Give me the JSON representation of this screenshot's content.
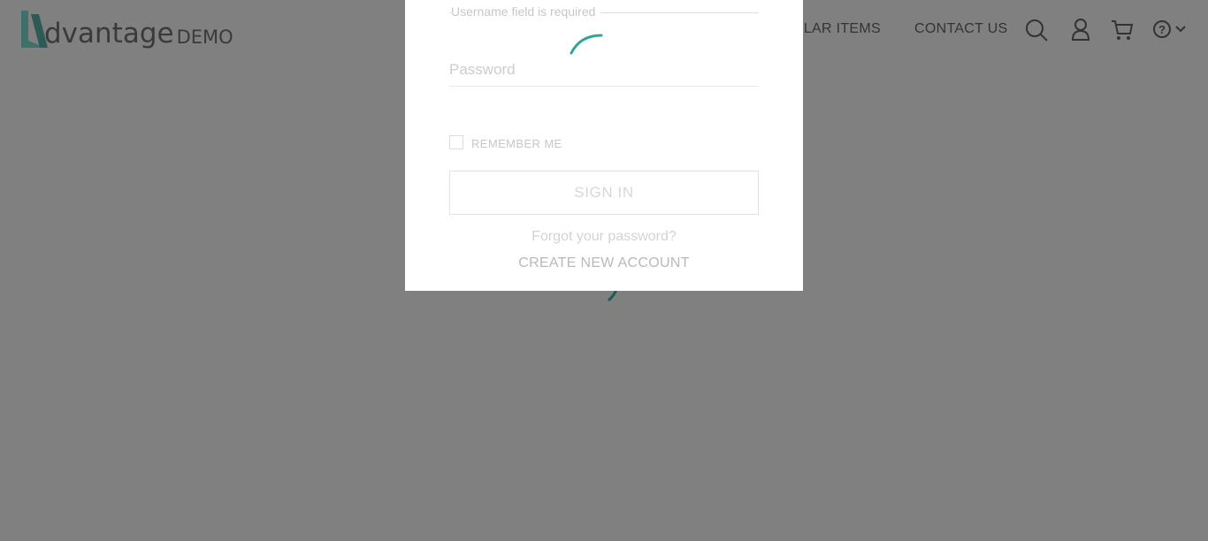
{
  "brand": {
    "word": "dvantage",
    "suffix": "DEMO",
    "accent": "#3f7f77"
  },
  "nav": {
    "popular_items": "POPULAR ITEMS",
    "contact_us": "CONTACT US"
  },
  "icons": {
    "search": "search-icon",
    "user": "user-icon",
    "cart": "cart-icon",
    "help": "help-icon",
    "chevron": "chevron-down-icon"
  },
  "login": {
    "username_error": "Username field is required",
    "password_label": "Password",
    "remember_me": "REMEMBER ME",
    "sign_in": "SIGN IN",
    "forgot_password": "Forgot your password?",
    "create_account": "CREATE NEW ACCOUNT"
  },
  "colors": {
    "overlay": "#808080",
    "spinner": "#2fa59a",
    "modal_bg": "#ffffff"
  }
}
